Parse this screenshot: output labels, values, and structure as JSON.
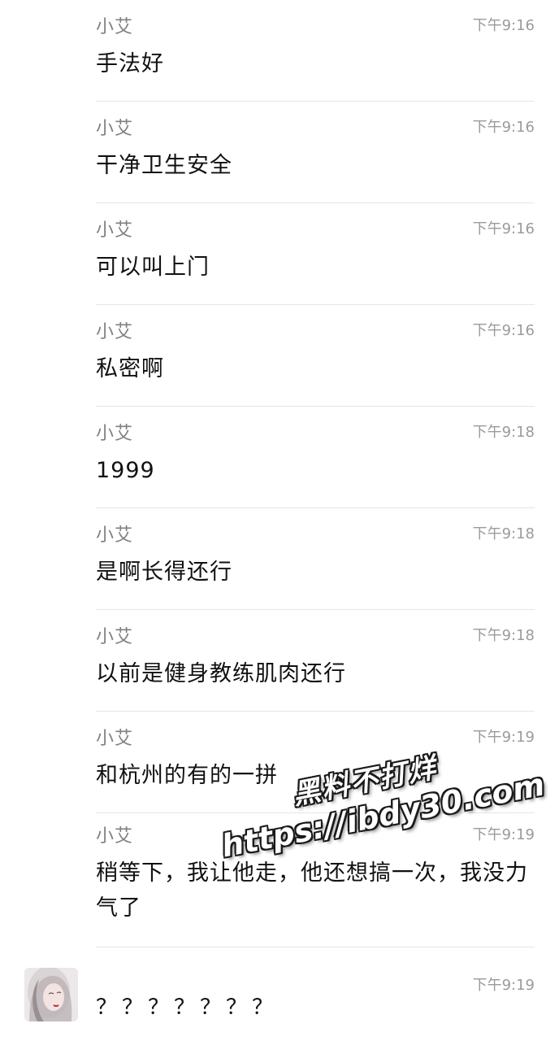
{
  "messages": [
    {
      "sender": "小艾",
      "time": "下午9:16",
      "text": "手法好"
    },
    {
      "sender": "小艾",
      "time": "下午9:16",
      "text": "干净卫生安全"
    },
    {
      "sender": "小艾",
      "time": "下午9:16",
      "text": "可以叫上门"
    },
    {
      "sender": "小艾",
      "time": "下午9:16",
      "text": "私密啊"
    },
    {
      "sender": "小艾",
      "time": "下午9:18",
      "text": "1999"
    },
    {
      "sender": "小艾",
      "time": "下午9:18",
      "text": "是啊长得还行"
    },
    {
      "sender": "小艾",
      "time": "下午9:18",
      "text": "以前是健身教练肌肉还行"
    },
    {
      "sender": "小艾",
      "time": "下午9:19",
      "text": "和杭州的有的一拼"
    },
    {
      "sender": "小艾",
      "time": "下午9:19",
      "text": "稍等下，我让他走，他还想搞一次，我没力气了"
    },
    {
      "sender": "",
      "time": "下午9:19",
      "text": "？？？？？？？"
    }
  ],
  "watermark": {
    "line1": "黑料不打烊",
    "line2": "https://ibdy30.com"
  },
  "colors": {
    "background": "#ffffff",
    "sender": "#808080",
    "time": "#9b9b9b",
    "text": "#111111",
    "divider": "#e5e5e5"
  }
}
